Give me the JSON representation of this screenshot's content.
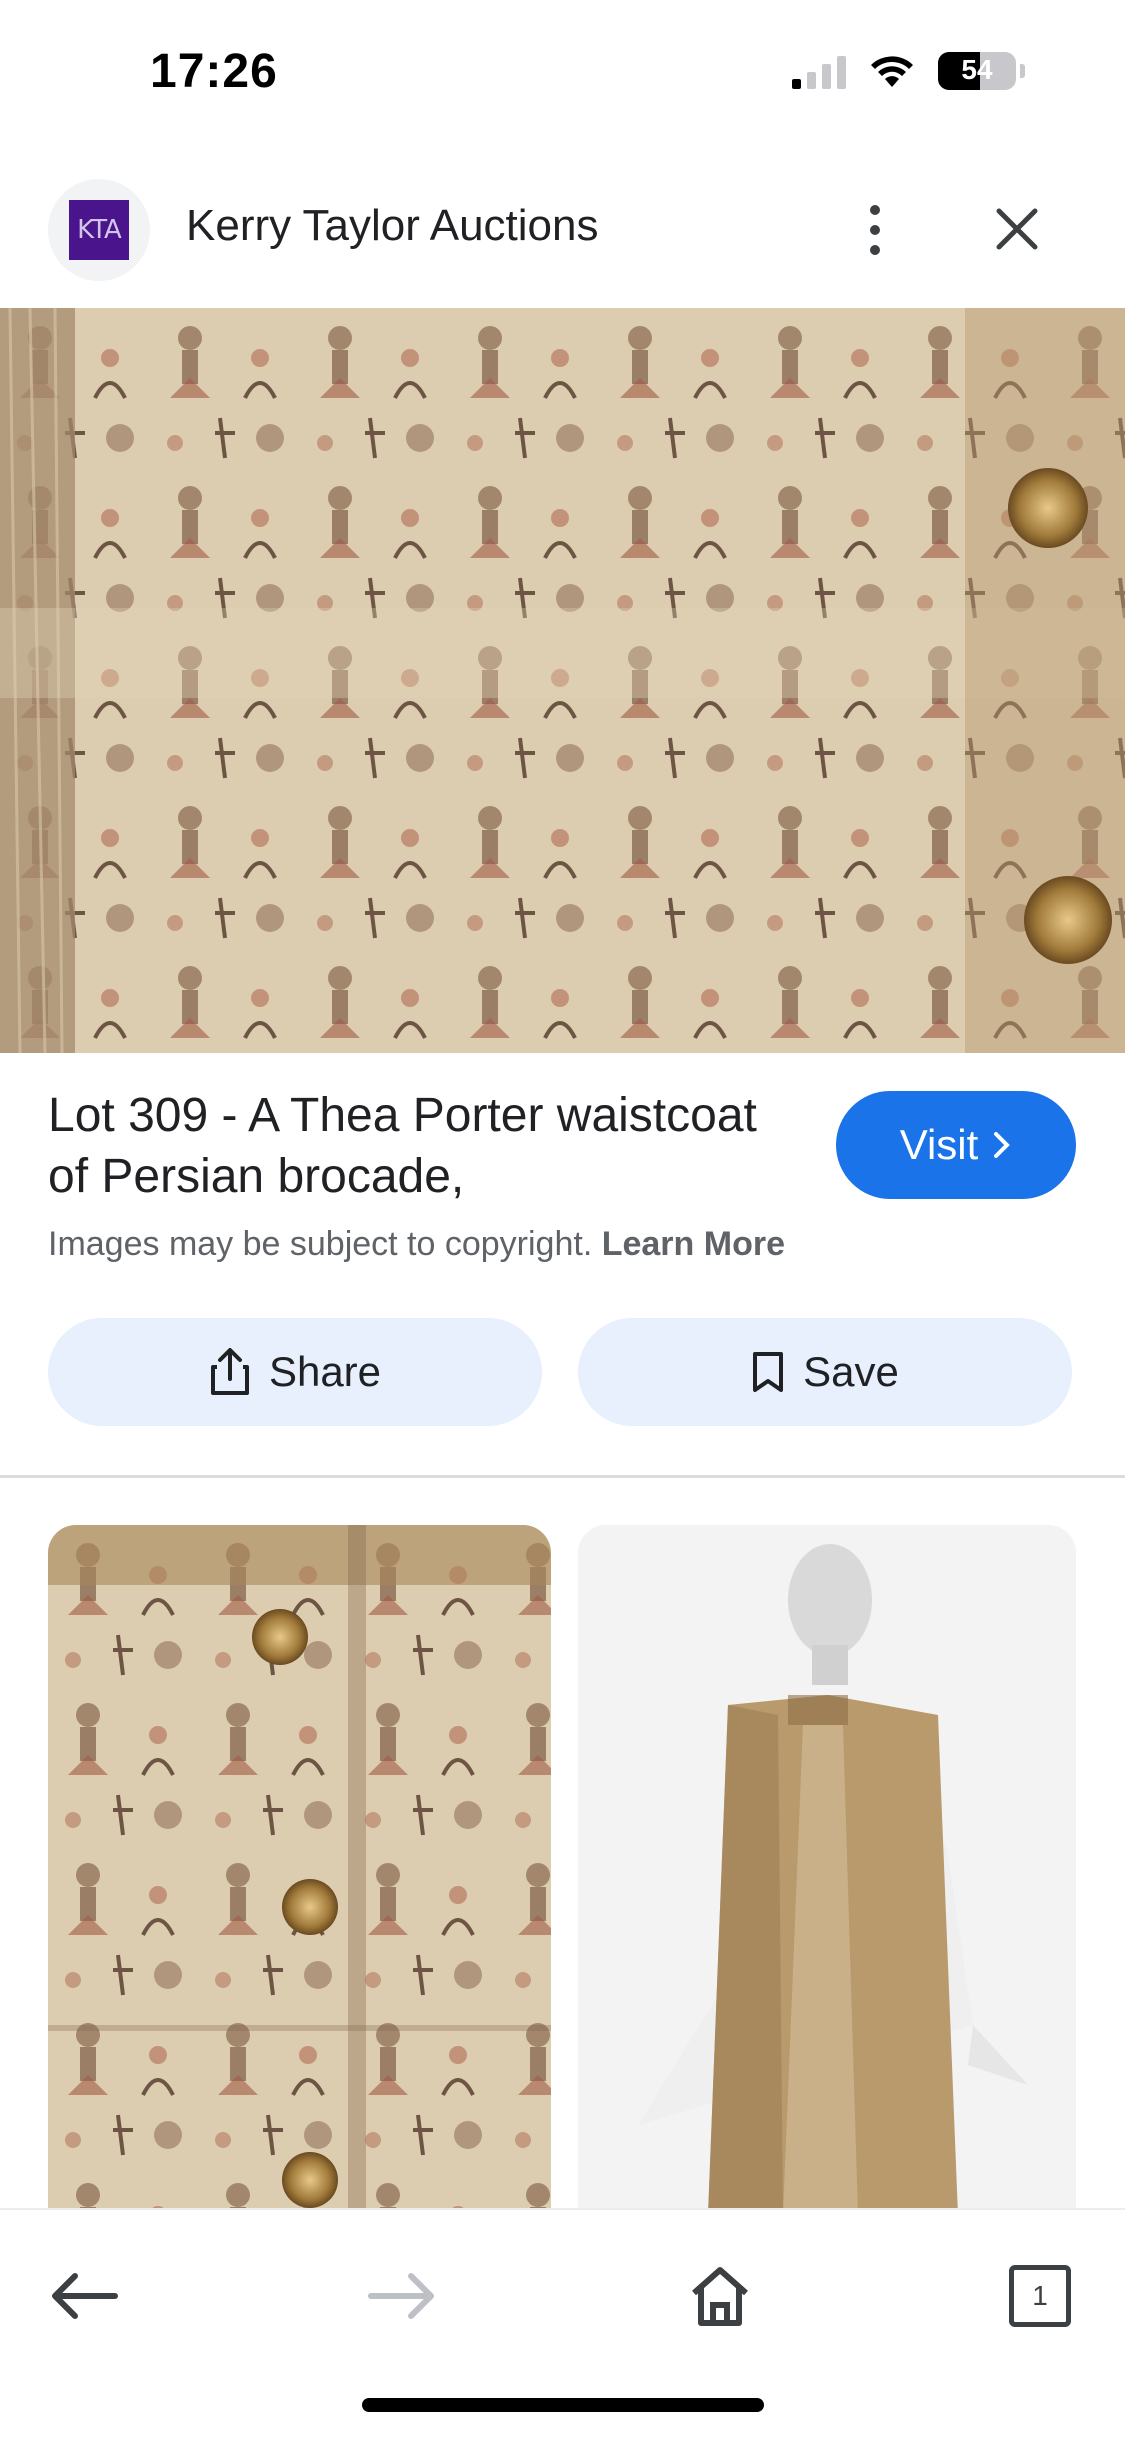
{
  "status_bar": {
    "time": "17:26",
    "battery": "54"
  },
  "header": {
    "site_logo": "KTA",
    "site_name": "Kerry Taylor Auctions"
  },
  "result": {
    "title": "Lot 309 - A Thea Porter waistcoat of Persian brocade,",
    "visit_label": "Visit",
    "copyright_text": "Images may be subject to copyright.",
    "learn_more": "Learn More",
    "share_label": "Share",
    "save_label": "Save"
  },
  "bottom_nav": {
    "tab_count": "1"
  },
  "colors": {
    "accent": "#1a73e8",
    "action_bg": "#e8f0fe",
    "logo_bg": "#4a148c"
  },
  "icons": [
    "cellular-signal-icon",
    "wifi-icon",
    "battery-icon",
    "more-vert-icon",
    "close-icon",
    "chevron-right-icon",
    "share-icon",
    "bookmark-icon",
    "back-arrow-icon",
    "forward-arrow-icon",
    "home-icon",
    "tabs-icon"
  ]
}
